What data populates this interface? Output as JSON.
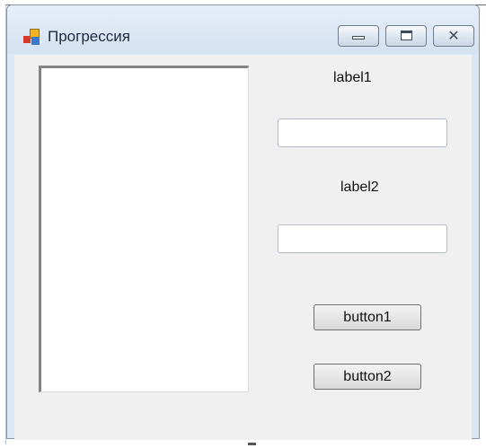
{
  "window": {
    "title": "Прогрессия",
    "icon": "winforms-app-icon",
    "controls": {
      "minimize": "minimize-icon",
      "maximize": "maximize-icon",
      "close": "close-icon",
      "close_glyph": "✕"
    }
  },
  "form": {
    "listbox": {
      "items": []
    },
    "label1": "label1",
    "textbox1": {
      "value": ""
    },
    "label2": "label2",
    "textbox2": {
      "value": ""
    },
    "button1": "button1",
    "button2": "button2"
  },
  "colors": {
    "titlebar": "#dbe7f4",
    "client": "#f0f0f0",
    "listbox": "#ffffff"
  }
}
